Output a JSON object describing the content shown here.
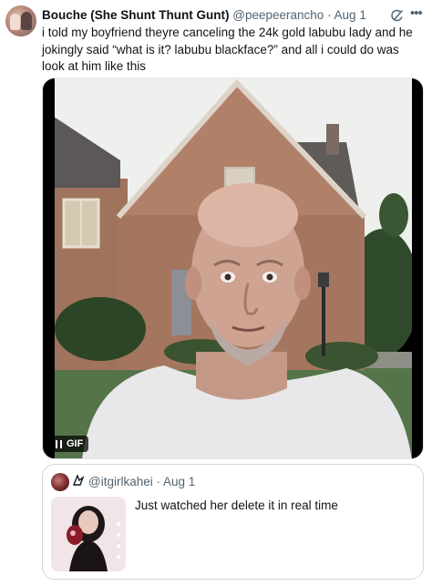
{
  "tweet": {
    "author_name": "Bouche (She Shunt Thunt Gunt)",
    "author_handle": "@peepeerancho",
    "separator": "·",
    "date": "Aug 1",
    "text": "i told my boyfriend theyre canceling the 24k gold labubu lady and he jokingly said “what is it? labubu blackface?” and all i could do was look at him like this",
    "media": {
      "type_label": "GIF",
      "pause_icon": "pause-icon"
    }
  },
  "quote": {
    "handle": "@itgirlkahei",
    "separator": "·",
    "date": "Aug 1",
    "text": "Just watched her delete it in real time"
  },
  "colors": {
    "text_primary": "#0f1419",
    "text_secondary": "#536471",
    "border": "#cfd9de"
  }
}
